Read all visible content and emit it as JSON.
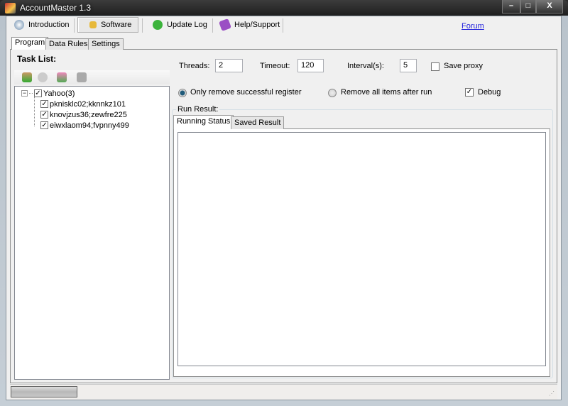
{
  "window": {
    "title": "AccountMaster 1.3",
    "minimize": "–",
    "maximize": "□",
    "close": "X"
  },
  "top_tabs": [
    {
      "label": "Introduction",
      "icon": "info-icon"
    },
    {
      "label": "Software",
      "icon": "software-icon",
      "selected": true
    },
    {
      "label": "Update Log",
      "icon": "recycle-icon"
    },
    {
      "label": "Help/Support",
      "icon": "book-icon"
    }
  ],
  "forum_link": "Forum",
  "inner_tabs": [
    {
      "label": "Program",
      "selected": true
    },
    {
      "label": "Data Rules"
    },
    {
      "label": "Settings"
    }
  ],
  "task_list": {
    "title": "Task List:",
    "toolbar": [
      "add-user-icon",
      "stop-icon",
      "users-icon",
      "delete-icon"
    ],
    "root": {
      "label": "Yahoo(3)",
      "checked": true
    },
    "items": [
      {
        "label": "pknisklc02;kknnkz101",
        "checked": true
      },
      {
        "label": "knovjzus36;zewfre225",
        "checked": true
      },
      {
        "label": "eiwxlaom94;fvpnny499",
        "checked": true
      }
    ]
  },
  "settings": {
    "threads_label": "Threads:",
    "threads": "2",
    "timeout_label": "Timeout:",
    "timeout": "120",
    "interval_label": "Interval(s):",
    "interval": "5",
    "save_proxy_label": "Save proxy",
    "save_proxy": false,
    "radio1": "Only remove successful register",
    "radio2": "Remove all items after run",
    "selected_radio": 1,
    "debug_label": "Debug",
    "debug": true
  },
  "run_result": {
    "label": "Run Result:",
    "tabs": [
      "Running Status",
      "Saved Result"
    ],
    "selected_tab": 0
  },
  "status": {
    "progress": 0
  }
}
